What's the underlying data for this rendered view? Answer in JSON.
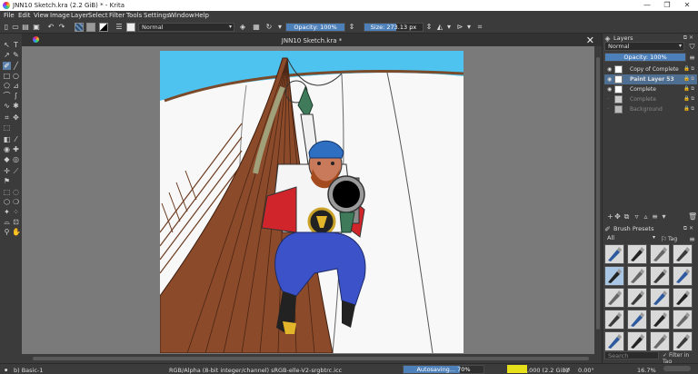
{
  "window": {
    "title": "JNN10 Sketch.kra (2.2 GiB)  * - Krita",
    "min": "—",
    "max": "❐",
    "close": "✕"
  },
  "menu": [
    "File",
    "Edit",
    "View",
    "Image",
    "Layer",
    "Select",
    "Filter",
    "Tools",
    "Settings",
    "Window",
    "Help"
  ],
  "toolbar": {
    "blend_mode": "Normal",
    "opacity_label": "Opacity: 100%",
    "opacity_value": 100,
    "size_label": "Size: 273.13 px",
    "size_fraction": 0.55
  },
  "document": {
    "tab_title": "JNN10 Sketch.kra *",
    "close": "✕"
  },
  "layers_panel": {
    "title": "Layers",
    "blend_mode": "Normal",
    "opacity_label": "Opacity:  100%",
    "layers": [
      {
        "name": "Copy of Complete",
        "visible": true,
        "selected": false,
        "dim": false
      },
      {
        "name": "Paint Layer 53",
        "visible": true,
        "selected": true,
        "dim": false
      },
      {
        "name": "Complete",
        "visible": true,
        "selected": false,
        "dim": false
      },
      {
        "name": "Complete",
        "visible": false,
        "selected": false,
        "dim": true
      },
      {
        "name": "Background",
        "visible": false,
        "selected": false,
        "dim": true
      }
    ]
  },
  "brush_panel": {
    "title": "Brush Presets",
    "filter_label": "All",
    "tag_label": "Tag",
    "search_placeholder": "Search",
    "filter_in_tag": "Filter in Tag"
  },
  "status": {
    "brush": "b) Basic-1",
    "color_info": "RGB/Alpha (8-bit integer/channel)  sRGB-elle-V2-srgbtrc.icc",
    "autosave": "Autosaving... 70%",
    "autosave_progress": 0.7,
    "memory": ",000 (2.2 GiB)",
    "rotation": "0.00°",
    "zoom": "16.7%"
  },
  "colors": {
    "accent": "#4d7fb8",
    "sky": "#4ec3ef",
    "sail": "#ffffff",
    "mast": "#8b4a2a"
  }
}
